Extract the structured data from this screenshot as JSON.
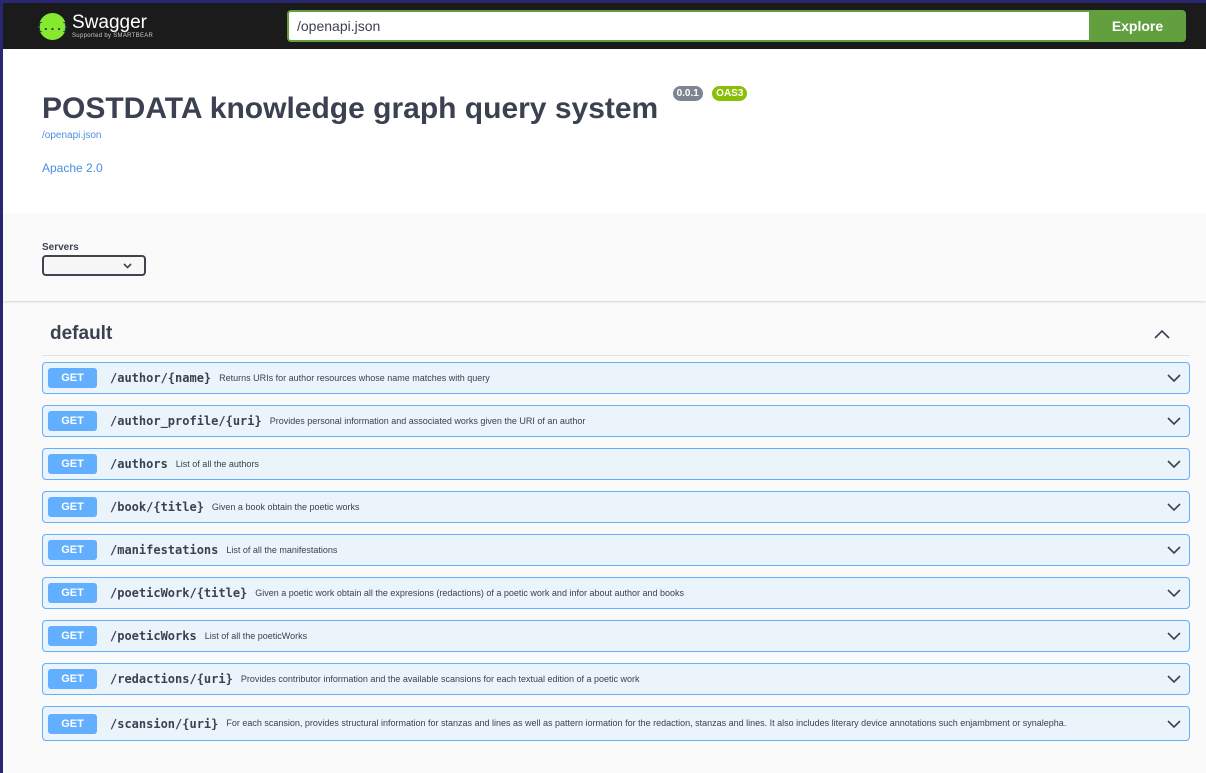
{
  "topbar": {
    "logo_glyph": "{...}",
    "logo_name": "Swagger",
    "logo_tagline": "Supported by SMARTBEAR",
    "url_value": "/openapi.json",
    "explore_label": "Explore"
  },
  "info": {
    "title": "POSTDATA knowledge graph query system",
    "version_badge": "0.0.1",
    "oas_badge": "OAS3",
    "spec_link": "/openapi.json",
    "license": "Apache 2.0"
  },
  "servers": {
    "label": "Servers",
    "selected": ""
  },
  "tag": {
    "name": "default",
    "toggle": "^"
  },
  "operations": [
    {
      "method": "GET",
      "path": "/author/{name}",
      "summary": "Returns URIs for author resources whose name matches with query"
    },
    {
      "method": "GET",
      "path": "/author_profile/{uri}",
      "summary": "Provides personal information and associated works given the URI of an author"
    },
    {
      "method": "GET",
      "path": "/authors",
      "summary": "List of all the authors"
    },
    {
      "method": "GET",
      "path": "/book/{title}",
      "summary": "Given a book obtain the poetic works"
    },
    {
      "method": "GET",
      "path": "/manifestations",
      "summary": "List of all the manifestations"
    },
    {
      "method": "GET",
      "path": "/poeticWork/{title}",
      "summary": "Given a poetic work obtain all the expresions (redactions) of a poetic work and infor about author and books"
    },
    {
      "method": "GET",
      "path": "/poeticWorks",
      "summary": "List of all the poeticWorks"
    },
    {
      "method": "GET",
      "path": "/redactions/{uri}",
      "summary": "Provides contributor information and the available scansions for each textual edition of a poetic work"
    },
    {
      "method": "GET",
      "path": "/scansion/{uri}",
      "summary": "For each scansion, provides structural information for stanzas and lines as well as pattern iormation for the redaction, stanzas and lines. It also includes literary device annotations such enjambment or synalepha."
    }
  ],
  "colors": {
    "topbar_bg": "#1b1b1b",
    "explore_green": "#62a03f",
    "get_blue": "#61affe",
    "get_bg": "#ebf3fb",
    "link_blue": "#4990e2",
    "oas_green": "#89bf04"
  }
}
